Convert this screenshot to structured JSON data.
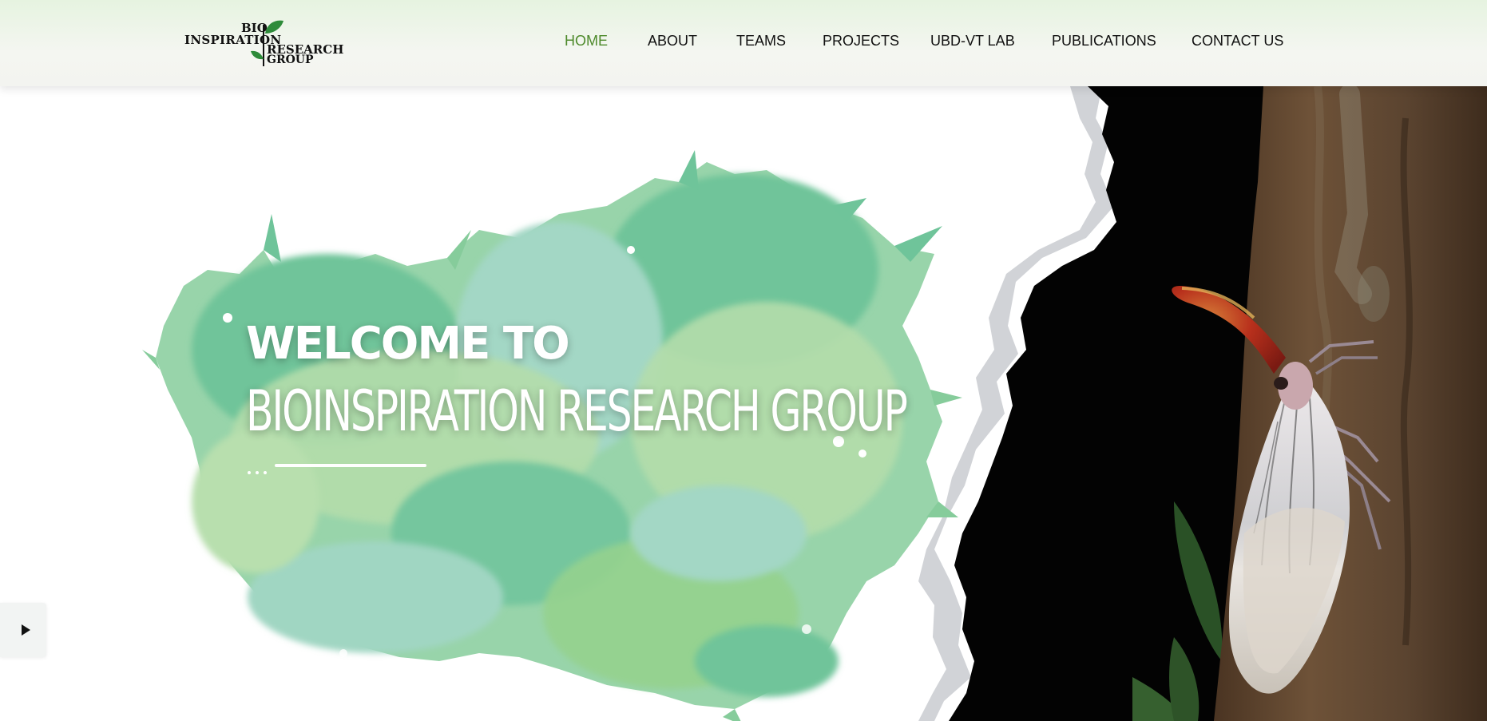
{
  "header": {
    "logo": {
      "line1": "BIO",
      "line2": "INSPIRATION",
      "line3": "RESEARCH",
      "line4": "GROUP"
    },
    "nav": [
      {
        "label": "HOME",
        "active": true
      },
      {
        "label": "ABOUT",
        "active": false
      },
      {
        "label": "TEAMS",
        "active": false
      },
      {
        "label": "PROJECTS",
        "active": false
      },
      {
        "label": "UBD-VT LAB",
        "active": false
      },
      {
        "label": "PUBLICATIONS",
        "active": false
      },
      {
        "label": "CONTACT US",
        "active": false
      }
    ]
  },
  "hero": {
    "title_line1": "WELCOME TO",
    "title_line2": "BIOINSPIRATION RESEARCH GROUP",
    "play_icon": "play-icon"
  },
  "colors": {
    "nav_active": "#4d8a2b",
    "nav_text": "#111111",
    "splash_dark": "#6fc49a",
    "splash_light": "#b3dcaa",
    "splash_teal": "#9fd6c2"
  }
}
